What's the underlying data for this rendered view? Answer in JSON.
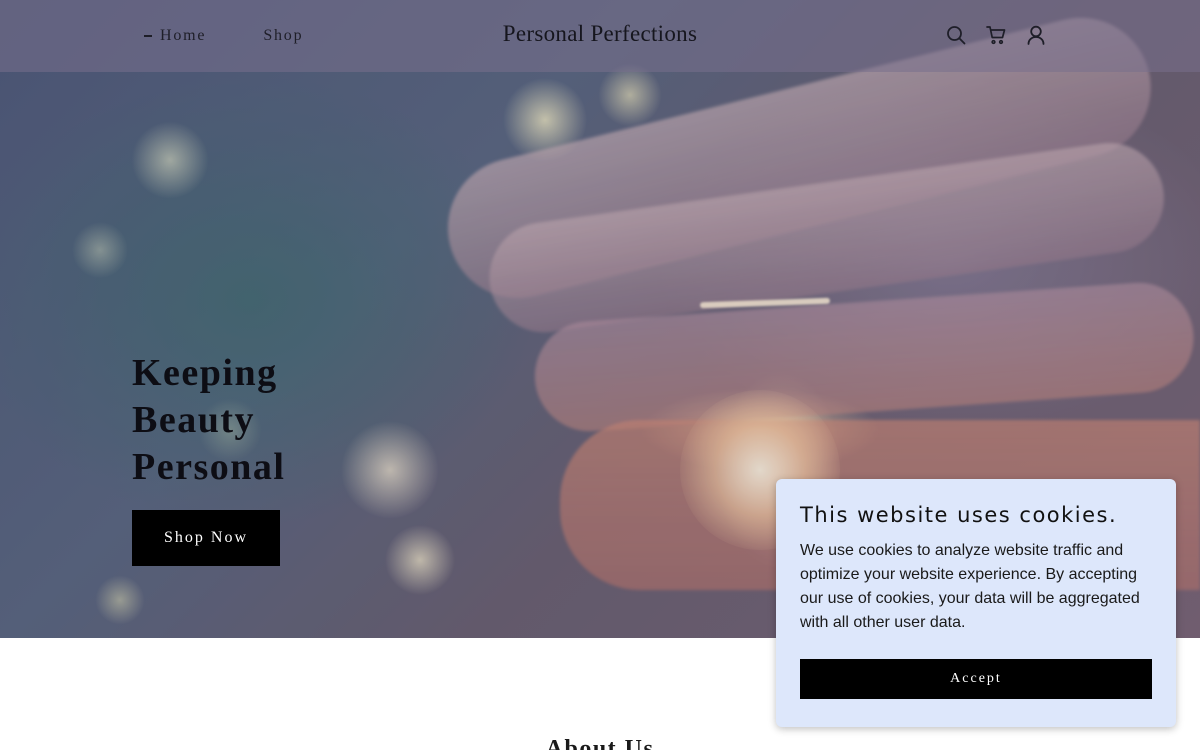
{
  "header": {
    "site_title": "Personal Perfections",
    "nav": [
      {
        "label": "Home",
        "active": true
      },
      {
        "label": "Shop",
        "active": false
      }
    ],
    "icons": [
      "search-icon",
      "cart-icon",
      "account-icon"
    ]
  },
  "hero": {
    "headline_lines": [
      "Keeping",
      "Beauty",
      "Personal"
    ],
    "cta_label": "Shop Now"
  },
  "about": {
    "title": "About Us"
  },
  "cookie_banner": {
    "title": "This website uses cookies.",
    "body": "We use cookies to analyze website traffic and optimize your website experience. By accepting our use of cookies, your data will be aggregated with all other user data.",
    "accept_label": "Accept"
  },
  "colors": {
    "header_overlay": "#78708c",
    "button_bg": "#000000",
    "cookie_bg": "#dde7fb"
  }
}
